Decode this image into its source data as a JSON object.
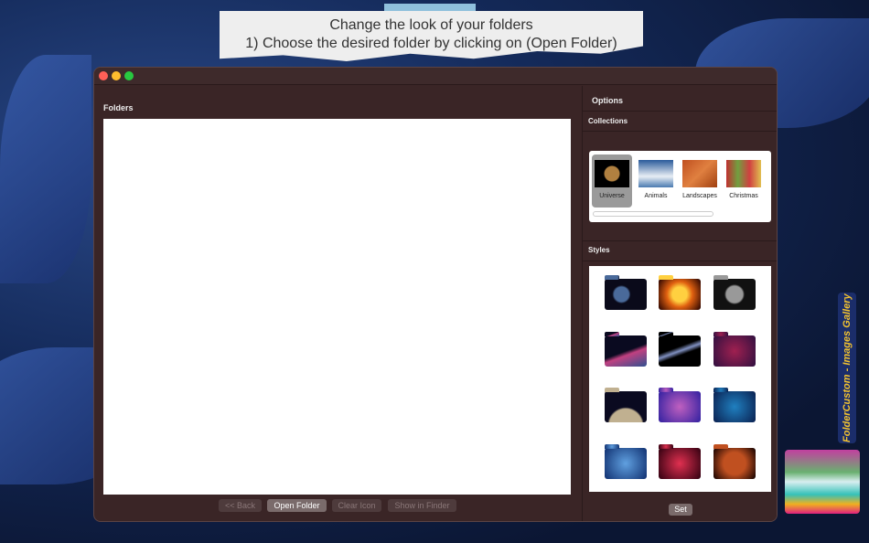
{
  "banner": {
    "line1": "Change the look of your folders",
    "line2": "1) Choose the desired folder by clicking on (Open Folder)"
  },
  "left": {
    "title": "Folders",
    "buttons": {
      "back": "<< Back",
      "open": "Open Folder",
      "clear": "Clear Icon",
      "finder": "Show in Finder"
    }
  },
  "right": {
    "title": "Options",
    "collections_label": "Collections",
    "styles_label": "Styles",
    "set": "Set",
    "collections": [
      {
        "label": "Universe",
        "selected": true
      },
      {
        "label": "Animals"
      },
      {
        "label": "Landscapes"
      },
      {
        "label": "Christmas"
      }
    ]
  },
  "branding": {
    "text": "FolderCustom - Images Gallery"
  },
  "colors": {
    "window_bg": "#3a2526",
    "close": "#ff5f57",
    "minimize": "#febc2e",
    "zoom": "#28c840"
  }
}
